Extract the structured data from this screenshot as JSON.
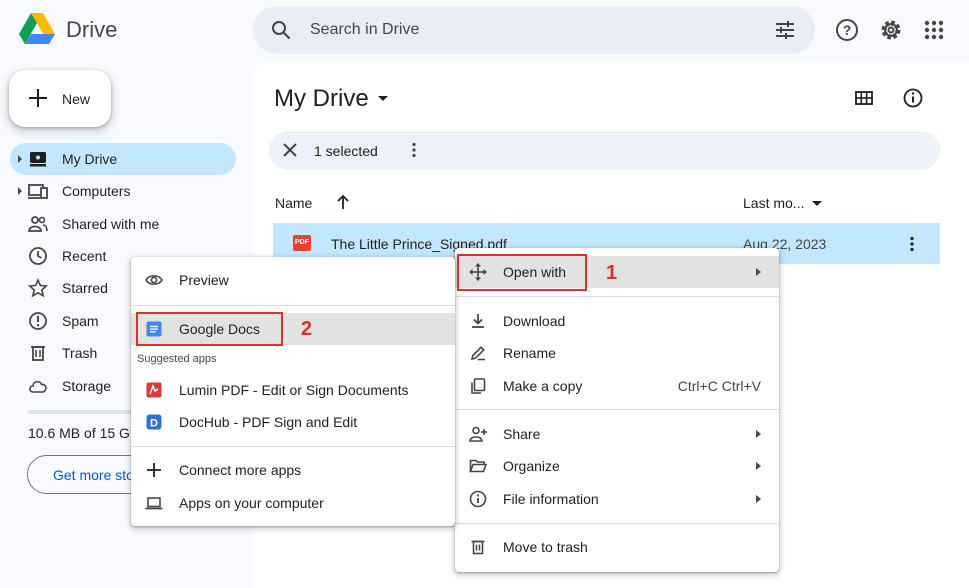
{
  "header": {
    "brand": "Drive",
    "search_placeholder": "Search in Drive"
  },
  "sidebar": {
    "new_label": "New",
    "items": [
      {
        "label": "My Drive",
        "icon": "my-drive-icon",
        "active": true
      },
      {
        "label": "Computers",
        "icon": "computers-icon"
      },
      {
        "label": "Shared with me",
        "icon": "shared-icon"
      },
      {
        "label": "Recent",
        "icon": "clock-icon"
      },
      {
        "label": "Starred",
        "icon": "star-icon"
      },
      {
        "label": "Spam",
        "icon": "spam-icon"
      },
      {
        "label": "Trash",
        "icon": "trash-icon"
      },
      {
        "label": "Storage",
        "icon": "cloud-icon"
      }
    ],
    "storage_text": "10.6 MB of 15 GB",
    "get_more_label": "Get more storage"
  },
  "main": {
    "title": "My Drive",
    "selection_text": "1 selected",
    "columns": {
      "name": "Name",
      "modified": "Last mo..."
    },
    "file": {
      "name": "The Little Prince_Signed.pdf",
      "date": "Aug 22, 2023",
      "type_badge": "PDF"
    }
  },
  "context_menu": {
    "open_with": "Open with",
    "download": "Download",
    "rename": "Rename",
    "make_copy": "Make a copy",
    "make_copy_shortcut": "Ctrl+C Ctrl+V",
    "share": "Share",
    "organize": "Organize",
    "file_information": "File information",
    "move_to_trash": "Move to trash"
  },
  "open_with_menu": {
    "preview": "Preview",
    "google_docs": "Google Docs",
    "suggested_apps": "Suggested apps",
    "lumin": "Lumin PDF - Edit or Sign Documents",
    "dochub": "DocHub - PDF Sign and Edit",
    "connect_more": "Connect more apps",
    "apps_on_computer": "Apps on your computer"
  },
  "annotations": {
    "step1": "1",
    "step2": "2"
  },
  "colors": {
    "accent": "#0b57d0",
    "selected": "#c2e7ff",
    "annotation": "#d93025"
  }
}
